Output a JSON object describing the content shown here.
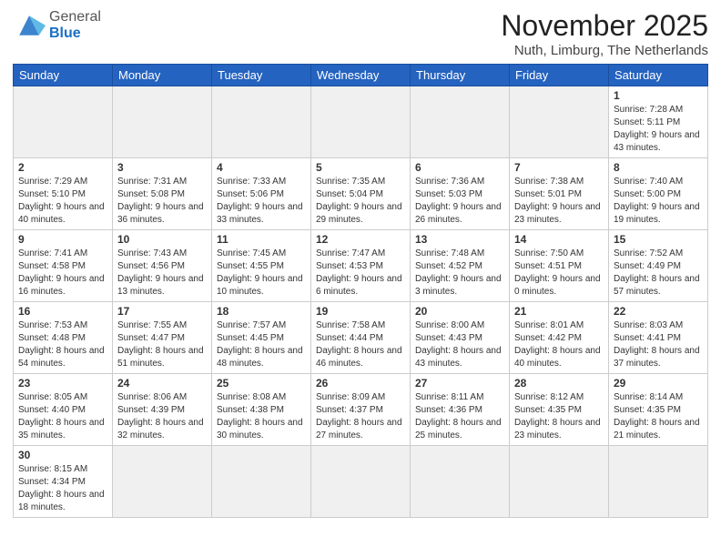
{
  "header": {
    "logo_general": "General",
    "logo_blue": "Blue",
    "month_title": "November 2025",
    "location": "Nuth, Limburg, The Netherlands"
  },
  "weekdays": [
    "Sunday",
    "Monday",
    "Tuesday",
    "Wednesday",
    "Thursday",
    "Friday",
    "Saturday"
  ],
  "weeks": [
    [
      {
        "day": "",
        "info": ""
      },
      {
        "day": "",
        "info": ""
      },
      {
        "day": "",
        "info": ""
      },
      {
        "day": "",
        "info": ""
      },
      {
        "day": "",
        "info": ""
      },
      {
        "day": "",
        "info": ""
      },
      {
        "day": "1",
        "info": "Sunrise: 7:28 AM\nSunset: 5:11 PM\nDaylight: 9 hours\nand 43 minutes."
      }
    ],
    [
      {
        "day": "2",
        "info": "Sunrise: 7:29 AM\nSunset: 5:10 PM\nDaylight: 9 hours\nand 40 minutes."
      },
      {
        "day": "3",
        "info": "Sunrise: 7:31 AM\nSunset: 5:08 PM\nDaylight: 9 hours\nand 36 minutes."
      },
      {
        "day": "4",
        "info": "Sunrise: 7:33 AM\nSunset: 5:06 PM\nDaylight: 9 hours\nand 33 minutes."
      },
      {
        "day": "5",
        "info": "Sunrise: 7:35 AM\nSunset: 5:04 PM\nDaylight: 9 hours\nand 29 minutes."
      },
      {
        "day": "6",
        "info": "Sunrise: 7:36 AM\nSunset: 5:03 PM\nDaylight: 9 hours\nand 26 minutes."
      },
      {
        "day": "7",
        "info": "Sunrise: 7:38 AM\nSunset: 5:01 PM\nDaylight: 9 hours\nand 23 minutes."
      },
      {
        "day": "8",
        "info": "Sunrise: 7:40 AM\nSunset: 5:00 PM\nDaylight: 9 hours\nand 19 minutes."
      }
    ],
    [
      {
        "day": "9",
        "info": "Sunrise: 7:41 AM\nSunset: 4:58 PM\nDaylight: 9 hours\nand 16 minutes."
      },
      {
        "day": "10",
        "info": "Sunrise: 7:43 AM\nSunset: 4:56 PM\nDaylight: 9 hours\nand 13 minutes."
      },
      {
        "day": "11",
        "info": "Sunrise: 7:45 AM\nSunset: 4:55 PM\nDaylight: 9 hours\nand 10 minutes."
      },
      {
        "day": "12",
        "info": "Sunrise: 7:47 AM\nSunset: 4:53 PM\nDaylight: 9 hours\nand 6 minutes."
      },
      {
        "day": "13",
        "info": "Sunrise: 7:48 AM\nSunset: 4:52 PM\nDaylight: 9 hours\nand 3 minutes."
      },
      {
        "day": "14",
        "info": "Sunrise: 7:50 AM\nSunset: 4:51 PM\nDaylight: 9 hours\nand 0 minutes."
      },
      {
        "day": "15",
        "info": "Sunrise: 7:52 AM\nSunset: 4:49 PM\nDaylight: 8 hours\nand 57 minutes."
      }
    ],
    [
      {
        "day": "16",
        "info": "Sunrise: 7:53 AM\nSunset: 4:48 PM\nDaylight: 8 hours\nand 54 minutes."
      },
      {
        "day": "17",
        "info": "Sunrise: 7:55 AM\nSunset: 4:47 PM\nDaylight: 8 hours\nand 51 minutes."
      },
      {
        "day": "18",
        "info": "Sunrise: 7:57 AM\nSunset: 4:45 PM\nDaylight: 8 hours\nand 48 minutes."
      },
      {
        "day": "19",
        "info": "Sunrise: 7:58 AM\nSunset: 4:44 PM\nDaylight: 8 hours\nand 46 minutes."
      },
      {
        "day": "20",
        "info": "Sunrise: 8:00 AM\nSunset: 4:43 PM\nDaylight: 8 hours\nand 43 minutes."
      },
      {
        "day": "21",
        "info": "Sunrise: 8:01 AM\nSunset: 4:42 PM\nDaylight: 8 hours\nand 40 minutes."
      },
      {
        "day": "22",
        "info": "Sunrise: 8:03 AM\nSunset: 4:41 PM\nDaylight: 8 hours\nand 37 minutes."
      }
    ],
    [
      {
        "day": "23",
        "info": "Sunrise: 8:05 AM\nSunset: 4:40 PM\nDaylight: 8 hours\nand 35 minutes."
      },
      {
        "day": "24",
        "info": "Sunrise: 8:06 AM\nSunset: 4:39 PM\nDaylight: 8 hours\nand 32 minutes."
      },
      {
        "day": "25",
        "info": "Sunrise: 8:08 AM\nSunset: 4:38 PM\nDaylight: 8 hours\nand 30 minutes."
      },
      {
        "day": "26",
        "info": "Sunrise: 8:09 AM\nSunset: 4:37 PM\nDaylight: 8 hours\nand 27 minutes."
      },
      {
        "day": "27",
        "info": "Sunrise: 8:11 AM\nSunset: 4:36 PM\nDaylight: 8 hours\nand 25 minutes."
      },
      {
        "day": "28",
        "info": "Sunrise: 8:12 AM\nSunset: 4:35 PM\nDaylight: 8 hours\nand 23 minutes."
      },
      {
        "day": "29",
        "info": "Sunrise: 8:14 AM\nSunset: 4:35 PM\nDaylight: 8 hours\nand 21 minutes."
      }
    ],
    [
      {
        "day": "30",
        "info": "Sunrise: 8:15 AM\nSunset: 4:34 PM\nDaylight: 8 hours\nand 18 minutes."
      },
      {
        "day": "",
        "info": ""
      },
      {
        "day": "",
        "info": ""
      },
      {
        "day": "",
        "info": ""
      },
      {
        "day": "",
        "info": ""
      },
      {
        "day": "",
        "info": ""
      },
      {
        "day": "",
        "info": ""
      }
    ]
  ]
}
